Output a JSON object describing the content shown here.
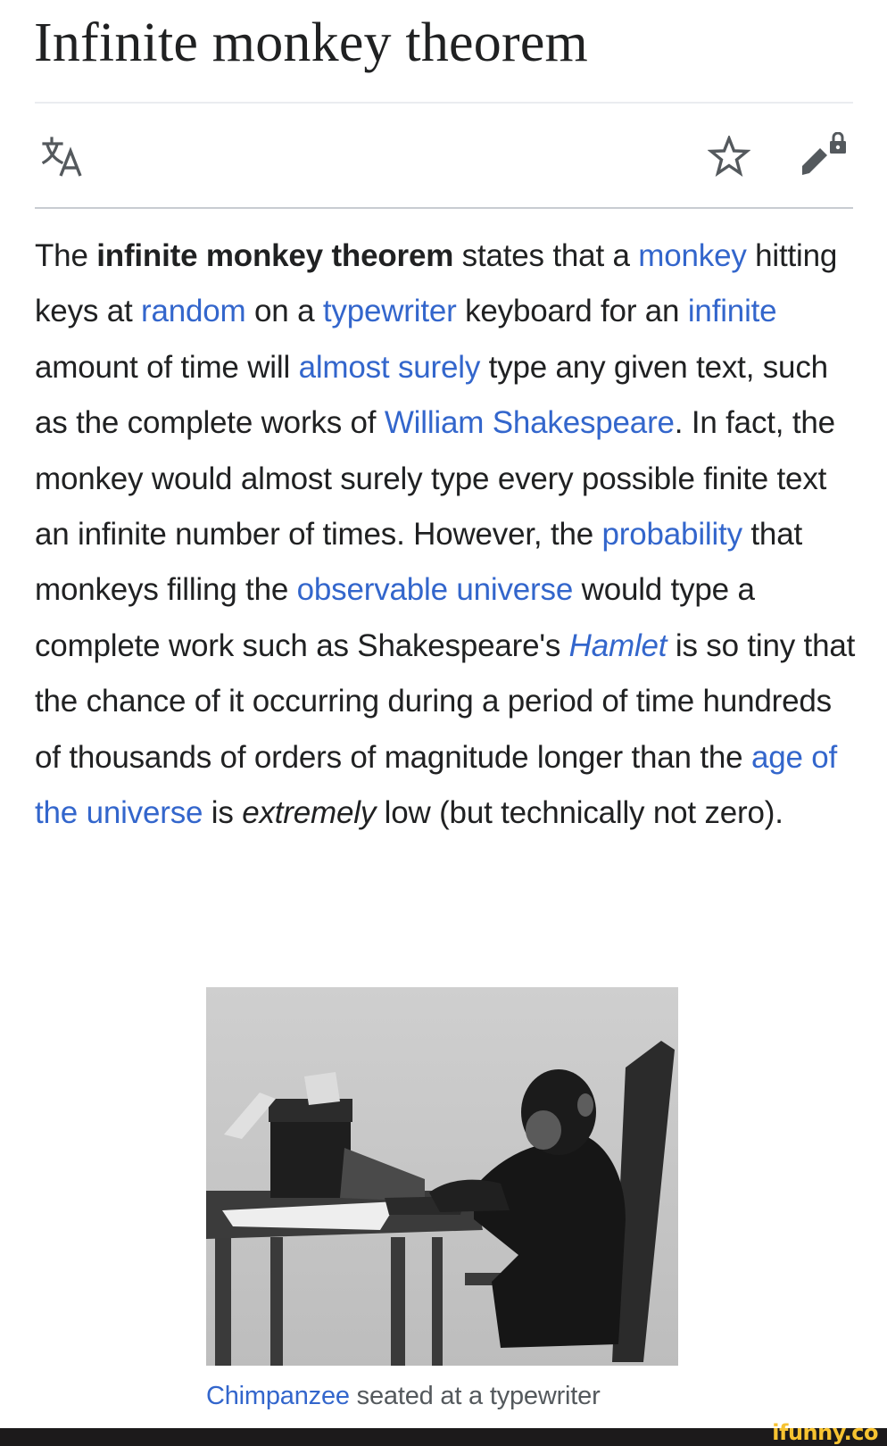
{
  "page": {
    "title": "Infinite monkey theorem"
  },
  "toolbar": {
    "language_icon": "translate-icon",
    "watch_icon": "star-icon",
    "edit_icon": "edit-locked-icon"
  },
  "article": {
    "segments": [
      {
        "type": "text",
        "text": "The "
      },
      {
        "type": "bold",
        "text": "infinite monkey theorem"
      },
      {
        "type": "text",
        "text": " states that a "
      },
      {
        "type": "link",
        "text": "monkey"
      },
      {
        "type": "text",
        "text": " hitting keys at "
      },
      {
        "type": "link",
        "text": "random"
      },
      {
        "type": "text",
        "text": " on a "
      },
      {
        "type": "link",
        "text": "typewriter"
      },
      {
        "type": "text",
        "text": " keyboard for an "
      },
      {
        "type": "link",
        "text": "infinite"
      },
      {
        "type": "text",
        "text": " amount of time will "
      },
      {
        "type": "link",
        "text": "almost surely"
      },
      {
        "type": "text",
        "text": " type any given text, such as the complete works of "
      },
      {
        "type": "link",
        "text": "William Shakespeare"
      },
      {
        "type": "text",
        "text": ". In fact, the monkey would almost surely type every possible finite text an infinite number of times. However, the "
      },
      {
        "type": "link",
        "text": "probability"
      },
      {
        "type": "text",
        "text": " that monkeys filling the "
      },
      {
        "type": "link",
        "text": "observable universe"
      },
      {
        "type": "text",
        "text": " would type a complete work such as Shakespeare's "
      },
      {
        "type": "italic-link",
        "text": "Hamlet"
      },
      {
        "type": "text",
        "text": " is so tiny that the chance of it occurring during a period of time hundreds of thousands of orders of magnitude longer than the "
      },
      {
        "type": "link",
        "text": "age of the universe"
      },
      {
        "type": "text",
        "text": " is "
      },
      {
        "type": "italic",
        "text": "extremely"
      },
      {
        "type": "text",
        "text": " low (but technically not zero)."
      }
    ]
  },
  "figure": {
    "alt": "Chimpanzee seated at a typewriter (black and white photo)",
    "caption_link": "Chimpanzee",
    "caption_text": " seated at a typewriter"
  },
  "footer": {
    "watermark": "ifunny.co"
  },
  "colors": {
    "link": "#3366cc",
    "text": "#202122",
    "icon": "#54595d",
    "footer_bg": "#1c1a1b",
    "footer_logo": "#f7c331"
  }
}
